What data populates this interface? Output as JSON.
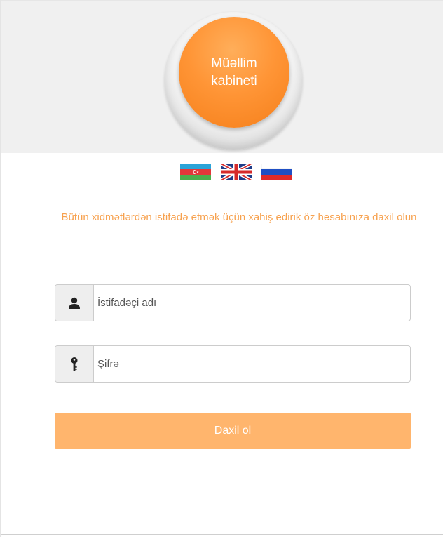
{
  "logo": {
    "line1": "Müəllim",
    "line2": "kabineti"
  },
  "languages": [
    {
      "code": "az",
      "icon": "azerbaijan-flag-icon"
    },
    {
      "code": "en",
      "icon": "uk-flag-icon"
    },
    {
      "code": "ru",
      "icon": "russia-flag-icon"
    }
  ],
  "intro_text": "Bütün xidmətlərdən istifadə etmək üçün xahiş edirik öz hesabınıza daxil olun",
  "form": {
    "username": {
      "placeholder": "İstifadəçi adı",
      "value": "",
      "icon": "user-icon"
    },
    "password": {
      "placeholder": "Şifrə",
      "value": "",
      "icon": "key-icon"
    },
    "submit_label": "Daxil ol"
  },
  "colors": {
    "accent": "#ff9536",
    "intro_text": "#f7a14e",
    "button_bg": "#ffb56d",
    "header_bg": "#f0f0f0"
  }
}
